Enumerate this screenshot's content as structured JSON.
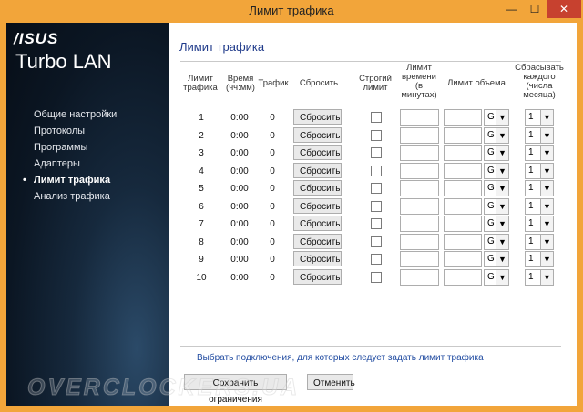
{
  "window": {
    "title": "Лимит трафика",
    "min": "—",
    "max": "☐",
    "close": "✕"
  },
  "sidebar": {
    "brand": "/ISUS",
    "app_name": "Turbo LAN",
    "items": [
      {
        "label": "Общие настройки",
        "active": false
      },
      {
        "label": "Протоколы",
        "active": false
      },
      {
        "label": "Программы",
        "active": false
      },
      {
        "label": "Адаптеры",
        "active": false
      },
      {
        "label": "Лимит трафика",
        "active": true
      },
      {
        "label": "Анализ трафика",
        "active": false
      }
    ]
  },
  "main": {
    "heading": "Лимит трафика",
    "columns": {
      "limit": "Лимит трафика",
      "time": "Время (чч:мм)",
      "traffic": "Трафик",
      "reset": "Сбросить",
      "strict": "Строгий лимит",
      "time_limit": "Лимит времени (в минутах)",
      "volume_limit": "Лимит объема",
      "reset_every": "Сбрасывать каждого (числа месяца)"
    },
    "rows": [
      {
        "num": "1",
        "time": "0:00",
        "traffic": "0",
        "reset": "Сбросить",
        "unit": "G",
        "day": "1"
      },
      {
        "num": "2",
        "time": "0:00",
        "traffic": "0",
        "reset": "Сбросить",
        "unit": "G",
        "day": "1"
      },
      {
        "num": "3",
        "time": "0:00",
        "traffic": "0",
        "reset": "Сбросить",
        "unit": "G",
        "day": "1"
      },
      {
        "num": "4",
        "time": "0:00",
        "traffic": "0",
        "reset": "Сбросить",
        "unit": "G",
        "day": "1"
      },
      {
        "num": "5",
        "time": "0:00",
        "traffic": "0",
        "reset": "Сбросить",
        "unit": "G",
        "day": "1"
      },
      {
        "num": "6",
        "time": "0:00",
        "traffic": "0",
        "reset": "Сбросить",
        "unit": "G",
        "day": "1"
      },
      {
        "num": "7",
        "time": "0:00",
        "traffic": "0",
        "reset": "Сбросить",
        "unit": "G",
        "day": "1"
      },
      {
        "num": "8",
        "time": "0:00",
        "traffic": "0",
        "reset": "Сбросить",
        "unit": "G",
        "day": "1"
      },
      {
        "num": "9",
        "time": "0:00",
        "traffic": "0",
        "reset": "Сбросить",
        "unit": "G",
        "day": "1"
      },
      {
        "num": "10",
        "time": "0:00",
        "traffic": "0",
        "reset": "Сбросить",
        "unit": "G",
        "day": "1"
      }
    ],
    "link_text": "Выбрать подключения, для которых следует задать лимит трафика",
    "save_label": "Сохранить ограничения",
    "cancel_label": "Отменить"
  },
  "watermark": "OVERCLOCKERS.UA",
  "colors": {
    "titlebar": "#f2a53a",
    "close": "#c7412f",
    "heading": "#1f3a8a",
    "link": "#1f4aa0"
  }
}
